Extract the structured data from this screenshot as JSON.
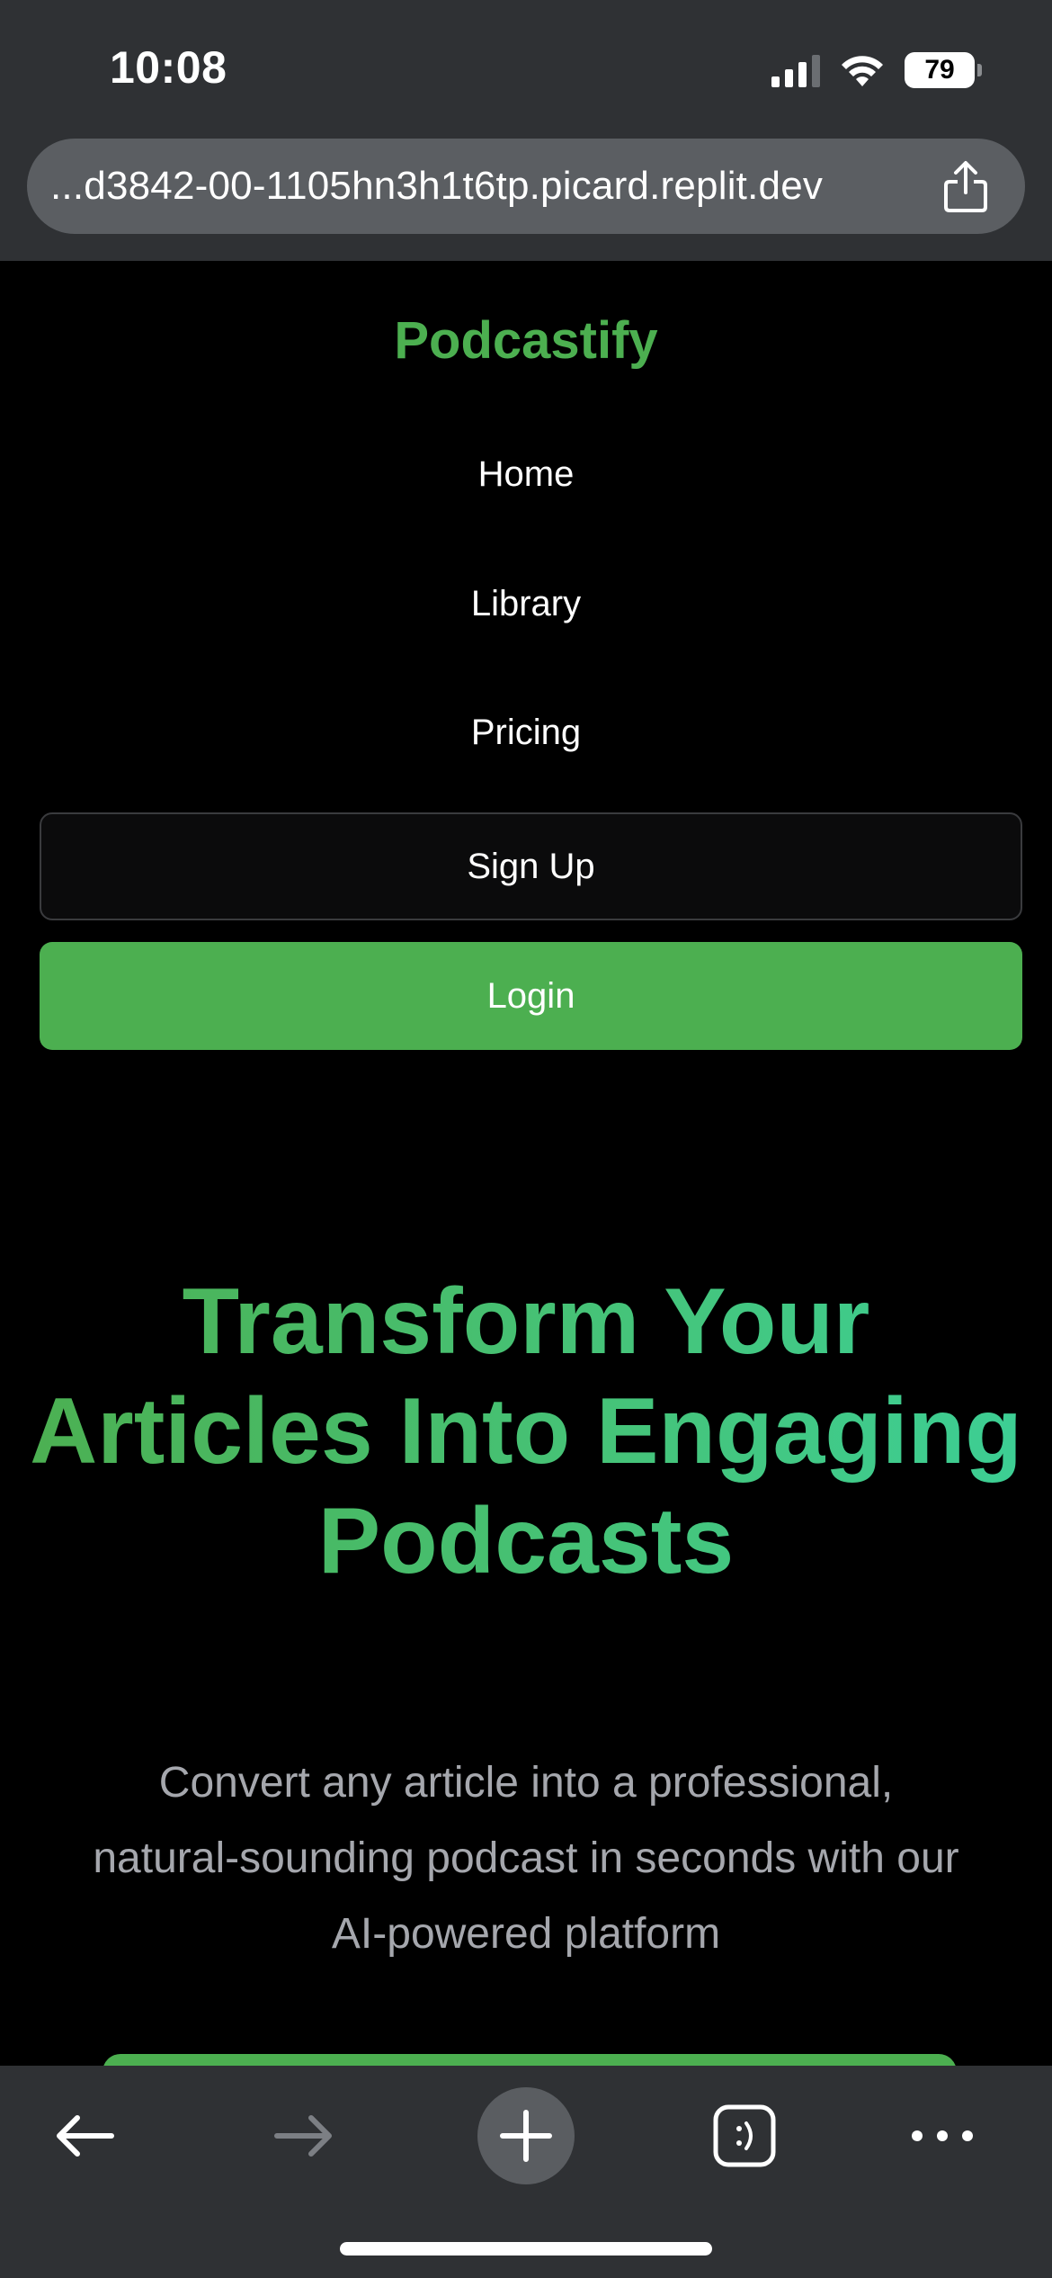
{
  "status_bar": {
    "time": "10:08",
    "battery": "79",
    "icons": [
      "signal-icon",
      "wifi-icon",
      "battery-icon"
    ]
  },
  "browser": {
    "url": "...d3842-00-1105hn3h1t6tp.picard.replit.dev",
    "share_icon": "share-icon",
    "toolbar_icons": [
      "back-arrow-icon",
      "forward-arrow-icon",
      "new-tab-plus-icon",
      "tabs-icon",
      "more-icon"
    ]
  },
  "nav": {
    "brand": "Podcastify",
    "links": [
      "Home",
      "Library",
      "Pricing"
    ],
    "signup_label": "Sign Up",
    "login_label": "Login"
  },
  "hero": {
    "title": "Transform Your Articles Into Engaging Podcasts",
    "subtitle": "Convert any article into a professional, natural-sounding podcast in seconds with our AI-powered platform"
  },
  "colors": {
    "accent": "#4caf50",
    "accent_teal": "#3ccf96",
    "background": "#000000",
    "chrome": "#2f3134",
    "subtitle_text": "#a5a7ad"
  }
}
